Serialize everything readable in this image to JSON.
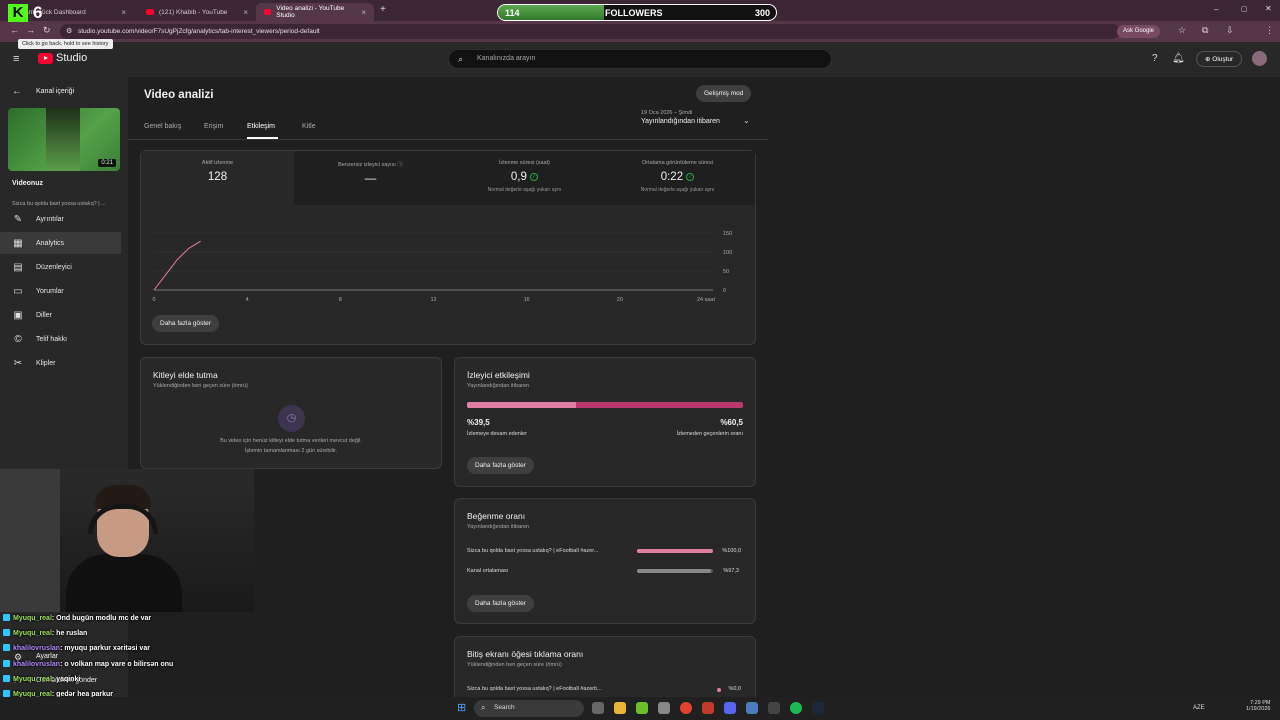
{
  "browser": {
    "tabs": [
      {
        "label": "am - Kick Dashboard"
      },
      {
        "label": "(121) Khabib - YouTube"
      },
      {
        "label": "Video analizi - YouTube Studio"
      }
    ],
    "url": "studio.youtube.com/video/F7sUgPjZcfg/analytics/tab-interest_viewers/period-default",
    "tooltip": "Click to go back, hold to see history",
    "ask_google": "Ask Google"
  },
  "overlay": {
    "kick_count": "6",
    "followers_current": "114",
    "followers_label": "FOLLOWERS",
    "followers_goal": "300",
    "followers_progress": 0.38
  },
  "studio": {
    "logo_text": "Studio",
    "search_placeholder": "Kanalınızda arayın",
    "create_label": "Oluştur",
    "sidebar": {
      "back_label": "Kanal içeriği",
      "thumb_duration": "0:21",
      "video_label": "Videonuz",
      "video_title": "Sizca bu qolda baxt yoxsa ustalıq? | ...",
      "items": [
        {
          "label": "Ayrıntılar",
          "icon": "pencil-icon"
        },
        {
          "label": "Analytics",
          "icon": "analytics-icon"
        },
        {
          "label": "Düzenleyici",
          "icon": "editor-icon"
        },
        {
          "label": "Yorumlar",
          "icon": "comments-icon"
        },
        {
          "label": "Diller",
          "icon": "subtitles-icon"
        },
        {
          "label": "Telif hakkı",
          "icon": "copyright-icon"
        },
        {
          "label": "Klipler",
          "icon": "scissors-icon"
        }
      ],
      "settings_label": "Ayarlar",
      "feedback_label": "Geri bildirim gönder"
    },
    "page_title": "Video analizi",
    "advanced_mode": "Gelişmiş mod",
    "tabs": [
      "Genel bakış",
      "Erişim",
      "Etkileşim",
      "Kitle"
    ],
    "active_tab": "Etkileşim",
    "period_date": "19 Oca 2026 – Şimdi",
    "period_label": "Yayınlandığından itibaren",
    "metrics": [
      {
        "label": "Aktif izlenme",
        "value": "128",
        "note": ""
      },
      {
        "label": "Benzersiz izleyici sayısı",
        "value": "—",
        "note": ""
      },
      {
        "label": "İzlenme süresi (saat)",
        "value": "0,9",
        "note": "Normal değerle aşağı yukarı aynı"
      },
      {
        "label": "Ortalama görüntüleme süresi",
        "value": "0:22",
        "note": "Normal değerle aşağı yukarı aynı"
      }
    ],
    "show_more": "Daha fazla göster",
    "retention": {
      "title": "Kitleyi elde tutma",
      "subtitle": "Yüklendiğinden beri geçen süre (ömrü)",
      "message_1": "Bu video için henüz kitleyi elde tutma verileri mevcut değil.",
      "message_2": "İşlemin tamamlanması 2 gün sürebilir."
    },
    "engagement": {
      "title": "İzleyici etkileşimi",
      "subtitle": "Yayınlandığından itibaren",
      "left_value": "%39,5",
      "left_label": "İzlemeye devam edenler",
      "right_value": "%60,5",
      "right_label": "İzlemeden geçenlerin oranı",
      "left_fraction": 0.395
    },
    "likes": {
      "title": "Beğenme oranı",
      "subtitle": "Yayınlandığından itibaren",
      "rows": [
        {
          "label": "Sizca bu qolda baxt yoxsa ustalıq? | eFootball #azer...",
          "value": "%100,0",
          "fraction": 1.0
        },
        {
          "label": "Kanal ortalaması",
          "value": "%97,3",
          "fraction": 0.973
        }
      ]
    },
    "endscreen": {
      "title": "Bitiş ekranı öğesi tıklama oranı",
      "subtitle": "Yüklendiğinden beri geçen süre (ömrü)",
      "row_label": "Sizca bu qolda baxt yoxsa ustalıq? | eFootball #azerb...",
      "row_value": "%0,0"
    }
  },
  "chart_data": {
    "type": "line",
    "x_ticks": [
      "0",
      "4",
      "8",
      "12",
      "16",
      "20",
      "24 saat"
    ],
    "y_ticks": [
      "150",
      "100",
      "50",
      "0"
    ],
    "xlim": [
      0,
      24
    ],
    "ylim": [
      0,
      150
    ],
    "series": [
      {
        "x": [
          0,
          0.5,
          1,
          1.5,
          2.0
        ],
        "y": [
          0,
          40,
          80,
          110,
          128
        ]
      }
    ]
  },
  "chat": [
    {
      "user": "Myuqu_real",
      "color": "g",
      "msg": ": Ond bugün modlu mc de var"
    },
    {
      "user": "Myuqu_real",
      "color": "g",
      "msg": ": he ruslan"
    },
    {
      "user": "khalilovruslan",
      "color": "p",
      "msg": ": myuqu parkur xəritəsi var"
    },
    {
      "user": "khalilovruslan",
      "color": "p",
      "msg": ": o volkan map vare o bilirsən onu"
    },
    {
      "user": "Myuqu_real",
      "color": "g",
      "msg": ": yaqinki"
    },
    {
      "user": "Myuqu_real",
      "color": "g",
      "msg": ": gedər hea parkur"
    },
    {
      "user": "Myuqu_real",
      "color": "g",
      "msg": ": off"
    }
  ],
  "taskbar": {
    "search_label": "Search",
    "lang": "AZE",
    "time": "7:29 PM",
    "date": "1/19/2026"
  },
  "colors": {
    "accent_pink": "#e07fa3",
    "green": "#53fc18"
  }
}
